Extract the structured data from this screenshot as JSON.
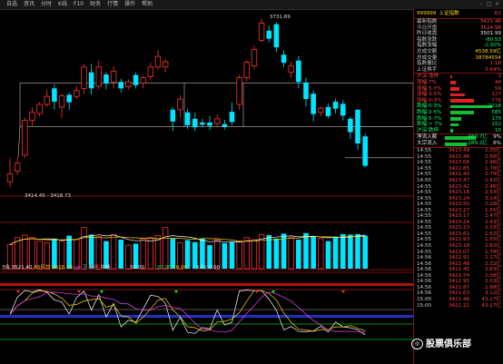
{
  "menu": [
    "自选",
    "资讯",
    "分时",
    "K线",
    "F10",
    "财务",
    "行情",
    "操作",
    "帮助"
  ],
  "header": {
    "code": "999999",
    "name": "上证指数",
    "indicator": "R2"
  },
  "kline": {
    "high_label": "3731.69",
    "low_label": "3414.45 - 3418.73",
    "candles": [
      {
        "o": 3425,
        "c": 3440,
        "h": 3470,
        "l": 3415,
        "up": true
      },
      {
        "o": 3445,
        "c": 3460,
        "h": 3470,
        "l": 3438,
        "up": true
      },
      {
        "o": 3475,
        "c": 3540,
        "h": 3545,
        "l": 3470,
        "up": true
      },
      {
        "o": 3540,
        "c": 3555,
        "h": 3565,
        "l": 3530,
        "up": true
      },
      {
        "o": 3553,
        "c": 3570,
        "h": 3574,
        "l": 3548,
        "up": true
      },
      {
        "o": 3570,
        "c": 3585,
        "h": 3598,
        "l": 3565,
        "up": true
      },
      {
        "o": 3600,
        "c": 3575,
        "h": 3608,
        "l": 3560,
        "up": false
      },
      {
        "o": 3565,
        "c": 3586,
        "h": 3590,
        "l": 3545,
        "up": true
      },
      {
        "o": 3588,
        "c": 3574,
        "h": 3592,
        "l": 3560,
        "up": false
      },
      {
        "o": 3585,
        "c": 3596,
        "h": 3605,
        "l": 3580,
        "up": true
      },
      {
        "o": 3600,
        "c": 3640,
        "h": 3645,
        "l": 3590,
        "up": true
      },
      {
        "o": 3630,
        "c": 3600,
        "h": 3646,
        "l": 3588,
        "up": false
      },
      {
        "o": 3604,
        "c": 3640,
        "h": 3652,
        "l": 3598,
        "up": true
      },
      {
        "o": 3626,
        "c": 3609,
        "h": 3630,
        "l": 3598,
        "up": false
      },
      {
        "o": 3612,
        "c": 3632,
        "h": 3641,
        "l": 3600,
        "up": true
      },
      {
        "o": 3612,
        "c": 3600,
        "h": 3618,
        "l": 3592,
        "up": false
      },
      {
        "o": 3603,
        "c": 3612,
        "h": 3617,
        "l": 3598,
        "up": true
      },
      {
        "o": 3625,
        "c": 3606,
        "h": 3630,
        "l": 3600,
        "up": false
      },
      {
        "o": 3610,
        "c": 3620,
        "h": 3623,
        "l": 3600,
        "up": true
      },
      {
        "o": 3622,
        "c": 3640,
        "h": 3648,
        "l": 3615,
        "up": true
      },
      {
        "o": 3640,
        "c": 3660,
        "h": 3672,
        "l": 3635,
        "up": true
      },
      {
        "o": 3640,
        "c": 3650,
        "h": 3655,
        "l": 3630,
        "up": true
      },
      {
        "o": 3560,
        "c": 3538,
        "h": 3565,
        "l": 3520,
        "up": false
      },
      {
        "o": 3560,
        "c": 3580,
        "h": 3587,
        "l": 3545,
        "up": true
      },
      {
        "o": 3555,
        "c": 3531,
        "h": 3562,
        "l": 3524,
        "up": false
      },
      {
        "o": 3543,
        "c": 3527,
        "h": 3555,
        "l": 3520,
        "up": false
      },
      {
        "o": 3536,
        "c": 3532,
        "h": 3543,
        "l": 3527,
        "up": false
      },
      {
        "o": 3536,
        "c": 3530,
        "h": 3548,
        "l": 3522,
        "up": false
      },
      {
        "o": 3534,
        "c": 3543,
        "h": 3551,
        "l": 3527,
        "up": true
      },
      {
        "o": 3533,
        "c": 3528,
        "h": 3541,
        "l": 3523,
        "up": false
      },
      {
        "o": 3556,
        "c": 3537,
        "h": 3574,
        "l": 3531,
        "up": false
      },
      {
        "o": 3570,
        "c": 3620,
        "h": 3625,
        "l": 3560,
        "up": true
      },
      {
        "o": 3620,
        "c": 3649,
        "h": 3653,
        "l": 3613,
        "up": true
      },
      {
        "o": 3642,
        "c": 3673,
        "h": 3680,
        "l": 3636,
        "up": true
      },
      {
        "o": 3690,
        "c": 3722,
        "h": 3731,
        "l": 3686,
        "up": true
      },
      {
        "o": 3708,
        "c": 3693,
        "h": 3717,
        "l": 3686,
        "up": false
      },
      {
        "o": 3720,
        "c": 3677,
        "h": 3724,
        "l": 3668,
        "up": false
      },
      {
        "o": 3663,
        "c": 3648,
        "h": 3671,
        "l": 3640,
        "up": false
      },
      {
        "o": 3630,
        "c": 3642,
        "h": 3650,
        "l": 3620,
        "up": true
      },
      {
        "o": 3652,
        "c": 3612,
        "h": 3661,
        "l": 3600,
        "up": false
      },
      {
        "o": 3611,
        "c": 3580,
        "h": 3620,
        "l": 3566,
        "up": false
      },
      {
        "o": 3590,
        "c": 3552,
        "h": 3596,
        "l": 3538,
        "up": false
      },
      {
        "o": 3555,
        "c": 3563,
        "h": 3566,
        "l": 3548,
        "up": true
      },
      {
        "o": 3565,
        "c": 3548,
        "h": 3572,
        "l": 3543,
        "up": false
      },
      {
        "o": 3575,
        "c": 3562,
        "h": 3581,
        "l": 3553,
        "up": false
      },
      {
        "o": 3571,
        "c": 3549,
        "h": 3578,
        "l": 3540,
        "up": false
      },
      {
        "o": 3543,
        "c": 3518,
        "h": 3547,
        "l": 3505,
        "up": false
      },
      {
        "o": 3560,
        "c": 3497,
        "h": 3561,
        "l": 3485,
        "up": false
      },
      {
        "o": 3510,
        "c": 3455,
        "h": 3515,
        "l": 3452,
        "up": false
      }
    ]
  },
  "volume": [
    0.48,
    0.62,
    0.67,
    0.62,
    0.55,
    0.52,
    0.6,
    0.55,
    0.66,
    0.58,
    0.82,
    0.68,
    0.64,
    0.55,
    0.68,
    0.58,
    0.47,
    0.5,
    0.6,
    0.62,
    0.66,
    0.82,
    0.6,
    0.52,
    0.57,
    0.53,
    0.6,
    0.47,
    0.58,
    0.51,
    0.53,
    0.55,
    0.62,
    0.58,
    0.68,
    0.67,
    0.6,
    0.7,
    0.62,
    0.58,
    0.71,
    0.64,
    0.6,
    0.55,
    0.64,
    0.69,
    0.68,
    0.69,
    0.66
  ],
  "indicator_bar": {
    "prefix": "3合",
    "v1": "3521.40",
    "name": "A5日均",
    "v2": "3616.78",
    "tags": [
      "up",
      "下",
      "红线",
      "中线"
    ],
    "n1": "50.00",
    "n2": "20.00",
    "n3": "10.00",
    "n4": "3.02",
    "n5": "0.00"
  },
  "stats": [
    {
      "label": "最新指数",
      "value": "3421.46",
      "color": "red"
    },
    {
      "label": "今日开盘",
      "value": "3524.98",
      "color": "red"
    },
    {
      "label": "昨日收盘",
      "value": "3501.99",
      "color": "white"
    },
    {
      "label": "指数涨跌",
      "value": "-80.53",
      "color": "green"
    },
    {
      "label": "指数涨幅",
      "value": "-2.30%",
      "color": "green"
    },
    {
      "label": "总成交额",
      "value": "4538.59亿",
      "color": "yellow"
    },
    {
      "label": "总成交量",
      "value": "38784554",
      "color": "yellow"
    },
    {
      "label": "指数量比",
      "value": "1.18",
      "color": "red"
    },
    {
      "label": "上证换手",
      "value": "0.64%",
      "color": "red"
    }
  ],
  "breadth": [
    {
      "label": "沪深 涨停",
      "value": "1",
      "color": "red",
      "bar": 2
    },
    {
      "label": "涨幅 7%",
      "value": "44",
      "color": "red",
      "bar": 6
    },
    {
      "label": "涨幅 5-7%",
      "value": "59",
      "color": "red",
      "bar": 10
    },
    {
      "label": "涨幅 3-5%",
      "value": "127",
      "color": "red",
      "bar": 16
    },
    {
      "label": "涨幅 0-3%",
      "value": "776",
      "color": "red",
      "bar": 26
    },
    {
      "label": "跌幅 0-3%",
      "value": "2218",
      "color": "green",
      "bar": 46
    },
    {
      "label": "跌幅 3-5%",
      "value": "585",
      "color": "green",
      "bar": 26
    },
    {
      "label": "跌幅 5-7%",
      "value": "173",
      "color": "green",
      "bar": 12
    },
    {
      "label": "跌幅 > 7%",
      "value": "152",
      "color": "green",
      "bar": 9
    },
    {
      "label": "沪深 跌停",
      "value": "10",
      "color": "green",
      "bar": 3
    }
  ],
  "flows": [
    {
      "label": "净流入额",
      "value": "-489.7亿",
      "pct": "9%",
      "color": "green",
      "bar": 34
    },
    {
      "label": "大宗流入",
      "value": "-289.2亿",
      "pct": "6%",
      "color": "green",
      "bar": 24
    }
  ],
  "ticks": [
    {
      "t": "14:55",
      "p": "3423.49",
      "v": "2.35亿"
    },
    {
      "t": "14:55",
      "p": "3423.46",
      "v": "2.56亿"
    },
    {
      "t": "14:55",
      "p": "3423.06",
      "v": "2.96亿"
    },
    {
      "t": "14:55",
      "p": "3422.85",
      "v": "1.78亿"
    },
    {
      "t": "14:55",
      "p": "3421.40",
      "v": "2.79亿"
    },
    {
      "t": "14:55",
      "p": "3423.47",
      "v": "2.42亿"
    },
    {
      "t": "14:55",
      "p": "3423.42",
      "v": "2.46亿"
    },
    {
      "t": "14:55",
      "p": "3423.18",
      "v": "2.53亿"
    },
    {
      "t": "14:55",
      "p": "3423.24",
      "v": "3.14亿"
    },
    {
      "t": "14:55",
      "p": "3423.50",
      "v": "2.28亿"
    },
    {
      "t": "14:55",
      "p": "3423.27",
      "v": "1.55亿"
    },
    {
      "t": "14:55",
      "p": "3423.17",
      "v": "2.47亿"
    },
    {
      "t": "14:55",
      "p": "3423.24",
      "v": "2.43亿"
    },
    {
      "t": "14:55",
      "p": "3423.23",
      "v": "2.03亿"
    },
    {
      "t": "14:55",
      "p": "3423.61",
      "v": "1.52亿"
    },
    {
      "t": "14:55",
      "p": "3422.93",
      "v": "1.55亿"
    },
    {
      "t": "14:55",
      "p": "3423.18",
      "v": "2.82亿"
    },
    {
      "t": "14:55",
      "p": "3423.07",
      "v": "1.78亿"
    },
    {
      "t": "14:56",
      "p": "3422.91",
      "v": "2.17亿"
    },
    {
      "t": "14:56",
      "p": "3422.48",
      "v": "2.32亿"
    },
    {
      "t": "14:56",
      "p": "3421.45",
      "v": "2.83亿"
    },
    {
      "t": "14:56",
      "p": "3421.74",
      "v": "2.38亿"
    },
    {
      "t": "14:56",
      "p": "3422.95",
      "v": "2.03亿"
    },
    {
      "t": "14:56",
      "p": "3422.87",
      "v": "2.98亿"
    },
    {
      "t": "14:56",
      "p": "3421.63",
      "v": "3.12亿"
    },
    {
      "t": "15:00",
      "p": "3421.46",
      "v": "43.27亿"
    },
    {
      "t": "15:00",
      "p": "3421.22",
      "v": "43.27亿"
    }
  ],
  "watermark": "股票俱乐部",
  "watermark_icon": "wechat-icon"
}
